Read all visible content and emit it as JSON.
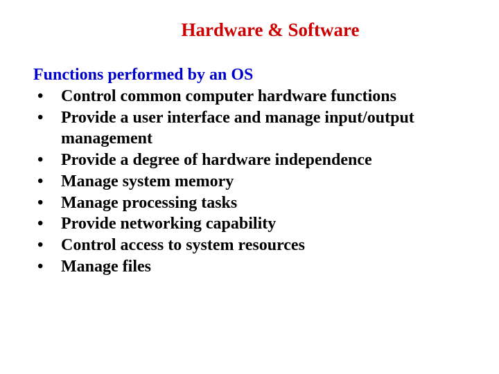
{
  "title": "Hardware & Software",
  "subhead": "Functions performed by an OS",
  "bullets": [
    "Control common computer hardware functions",
    "Provide a user interface and manage input/output management",
    "Provide a degree of hardware independence",
    "Manage system memory",
    "Manage processing tasks",
    "Provide networking capability",
    "Control access to system resources",
    "Manage files"
  ]
}
